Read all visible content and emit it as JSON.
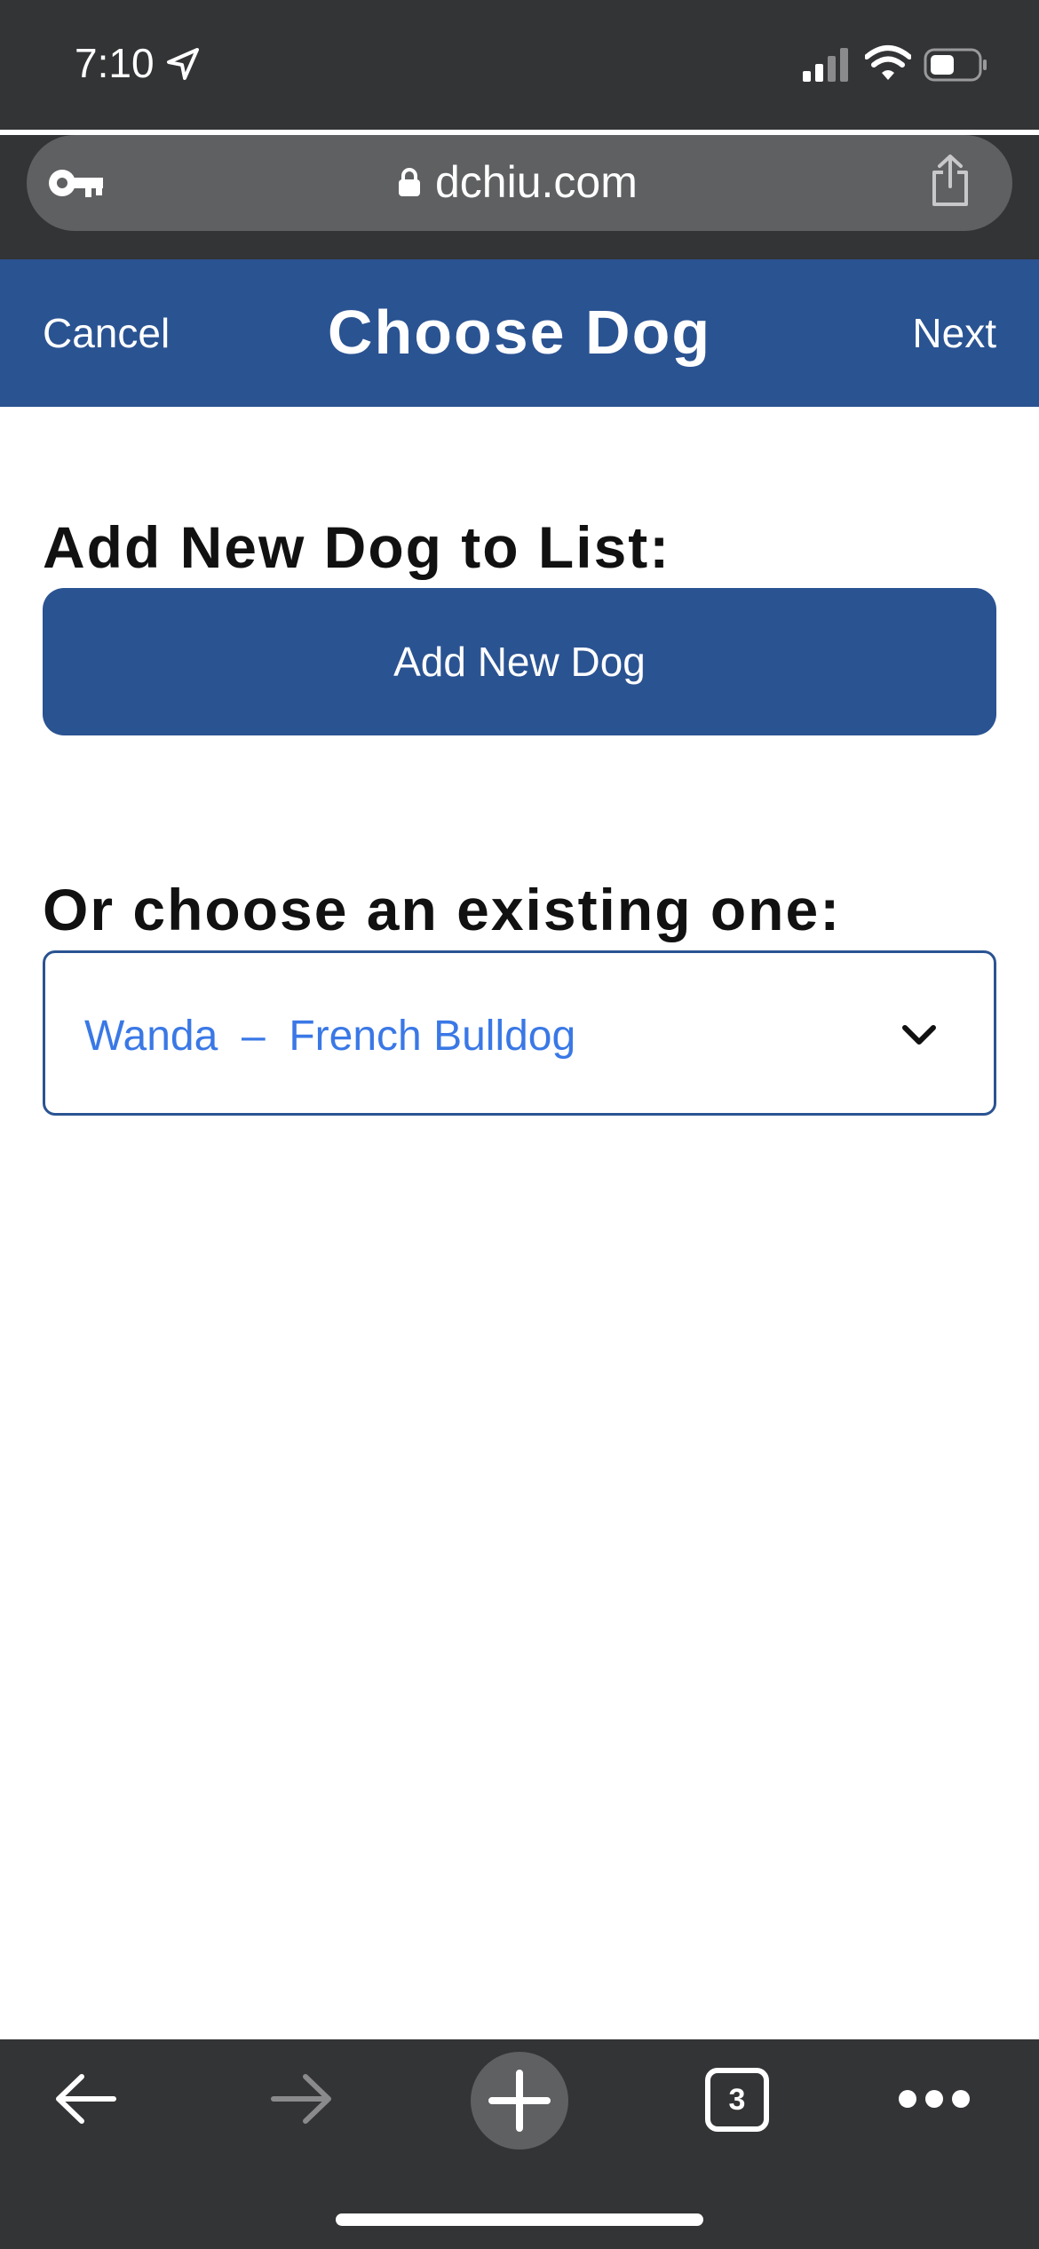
{
  "status_bar": {
    "time": "7:10"
  },
  "browser": {
    "url": "dchiu.com",
    "tab_count": "3"
  },
  "header": {
    "cancel_label": "Cancel",
    "title": "Choose Dog",
    "next_label": "Next"
  },
  "main": {
    "add_label": "Add New Dog to List:",
    "add_button_label": "Add New Dog",
    "existing_label": "Or choose an existing one:",
    "dog_select": {
      "selected": "Wanda  –  French Bulldog"
    }
  },
  "colors": {
    "brand": "#2a5392",
    "select_text": "#3a78e6",
    "chrome": "#333436"
  }
}
